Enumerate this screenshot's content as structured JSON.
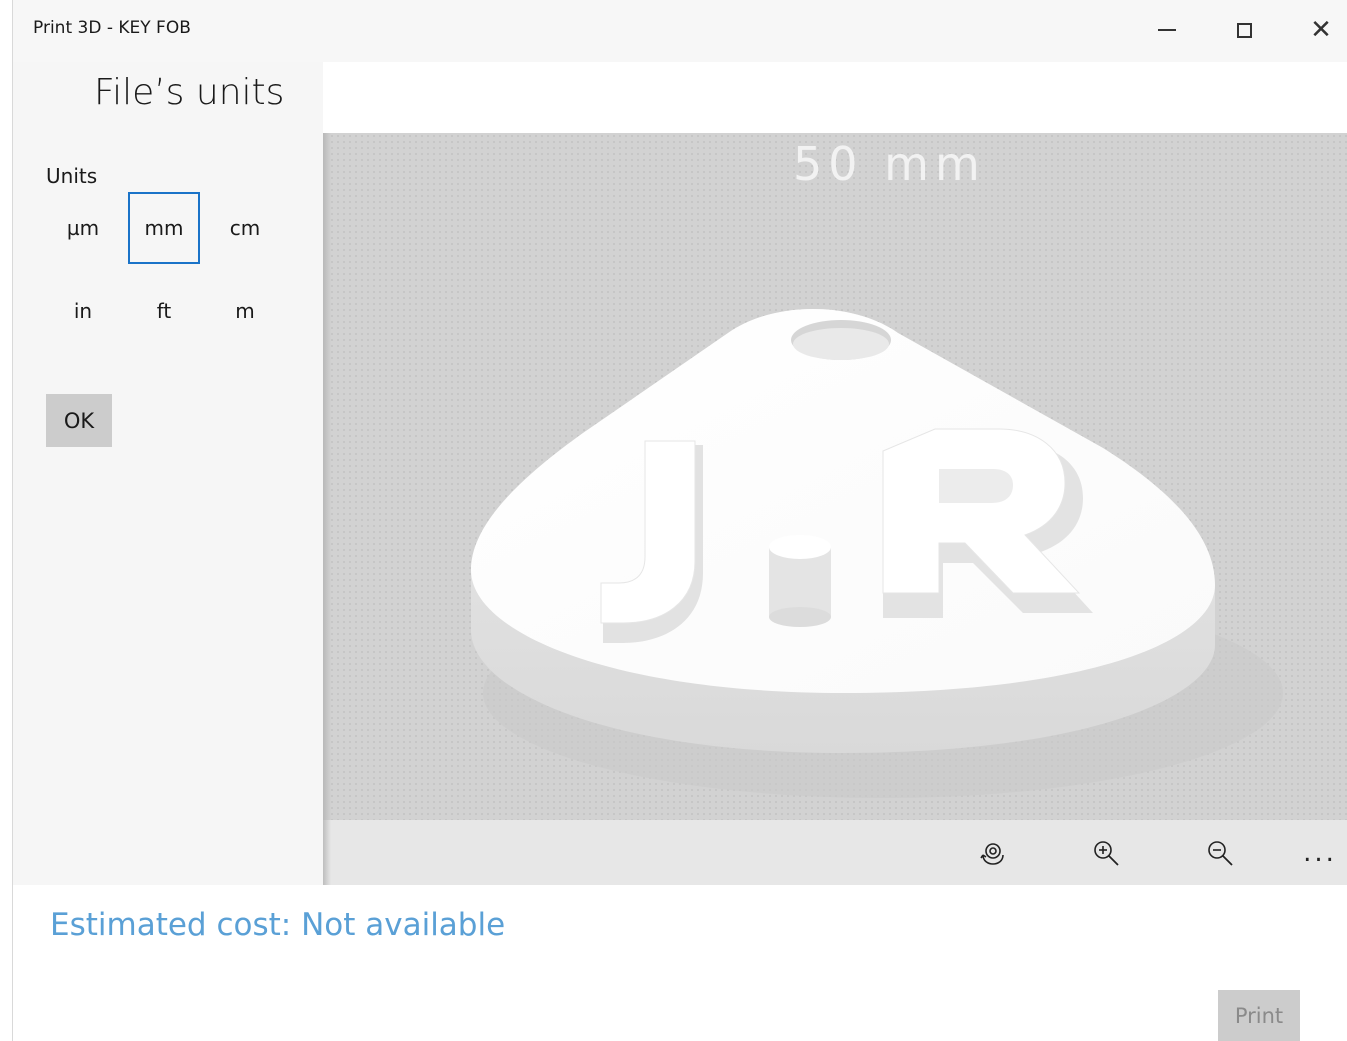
{
  "window": {
    "title": "Print 3D - KEY FOB",
    "minimize_icon": "minimize-icon",
    "maximize_icon": "maximize-icon",
    "close_glyph": "✕"
  },
  "sidebar": {
    "heading": "File’s units",
    "units_label": "Units",
    "units": [
      {
        "label": "µm",
        "selected": false
      },
      {
        "label": "mm",
        "selected": true
      },
      {
        "label": "cm",
        "selected": false
      },
      {
        "label": "in",
        "selected": false
      },
      {
        "label": "ft",
        "selected": false
      },
      {
        "label": "m",
        "selected": false
      }
    ],
    "ok_label": "OK"
  },
  "viewport": {
    "scale_label": "50 mm",
    "model_text": "J.R"
  },
  "toolbar": {
    "buttons": [
      {
        "icon": "reset-view-icon"
      },
      {
        "icon": "zoom-in-icon"
      },
      {
        "icon": "zoom-out-icon"
      }
    ],
    "more_label": "..."
  },
  "footer": {
    "cost_text": "Estimated cost: Not available",
    "print_label": "Print"
  },
  "colors": {
    "accent": "#1a73c8",
    "cost_text": "#5aa0d6",
    "viewport_bg": "#d2d2d2"
  }
}
